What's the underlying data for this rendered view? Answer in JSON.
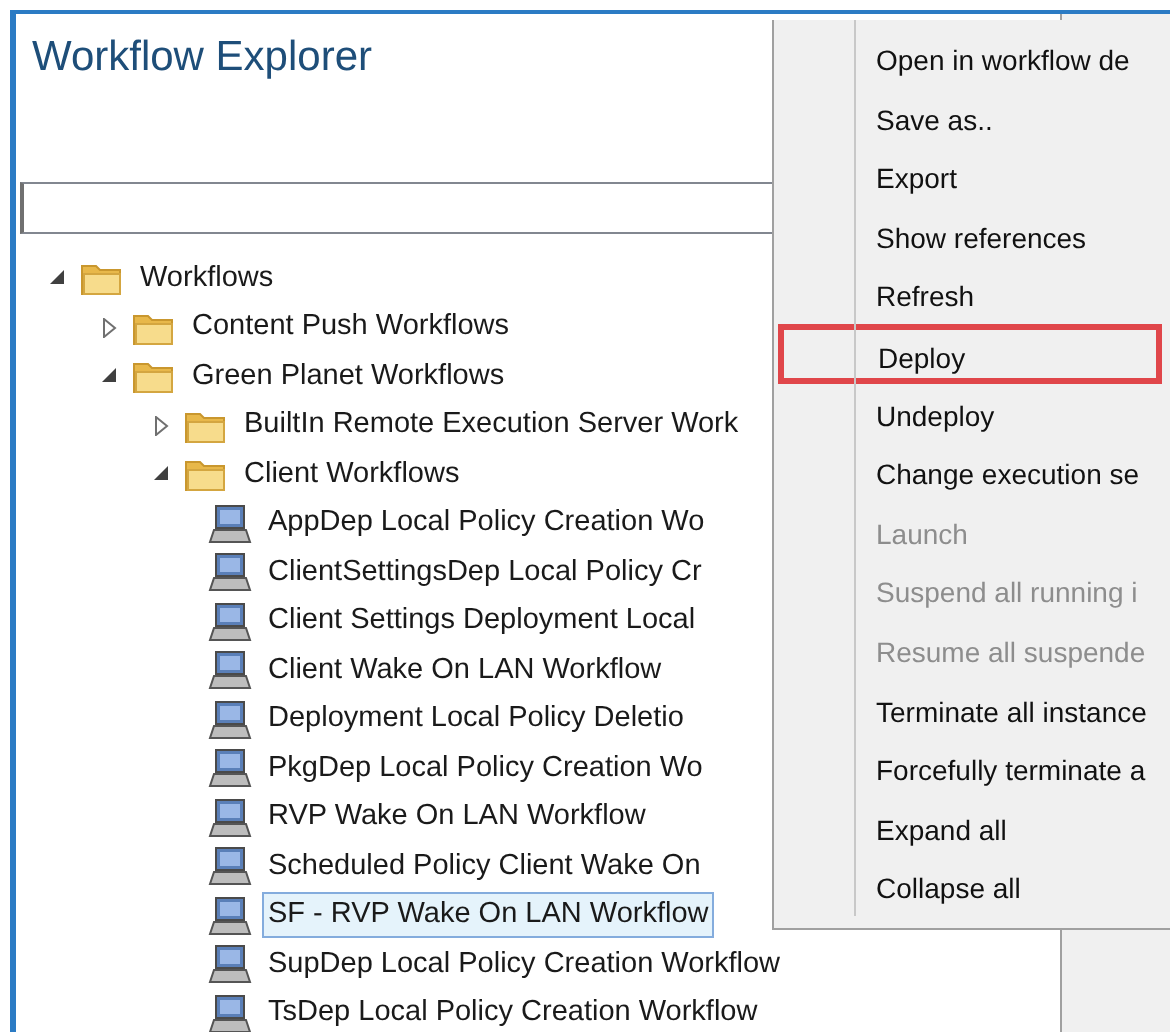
{
  "panel": {
    "title": "Workflow Explorer"
  },
  "tree": [
    {
      "label": "Workflows",
      "kind": "folder",
      "expanded": true,
      "selected": false,
      "children": [
        {
          "label": "Content Push Workflows",
          "kind": "folder",
          "expanded": false,
          "selected": false
        },
        {
          "label": "Green Planet Workflows",
          "kind": "folder",
          "expanded": true,
          "selected": false,
          "children": [
            {
              "label": "BuiltIn Remote Execution Server Work",
              "kind": "folder",
              "expanded": false,
              "selected": false
            },
            {
              "label": "Client Workflows",
              "kind": "folder",
              "expanded": true,
              "selected": false,
              "children": [
                {
                  "label": "AppDep Local Policy Creation Wo",
                  "kind": "workflow",
                  "selected": false
                },
                {
                  "label": "ClientSettingsDep Local Policy Cr",
                  "kind": "workflow",
                  "selected": false
                },
                {
                  "label": "Client Settings Deployment Local",
                  "kind": "workflow",
                  "selected": false
                },
                {
                  "label": "Client Wake On LAN Workflow",
                  "kind": "workflow",
                  "selected": false
                },
                {
                  "label": "Deployment Local Policy Deletio",
                  "kind": "workflow",
                  "selected": false
                },
                {
                  "label": "PkgDep Local Policy Creation Wo",
                  "kind": "workflow",
                  "selected": false
                },
                {
                  "label": "RVP Wake On LAN Workflow",
                  "kind": "workflow",
                  "selected": false
                },
                {
                  "label": "Scheduled Policy Client Wake On",
                  "kind": "workflow",
                  "selected": false
                },
                {
                  "label": "SF - RVP Wake On LAN Workflow",
                  "kind": "workflow",
                  "selected": true
                },
                {
                  "label": "SupDep Local Policy Creation Workflow",
                  "kind": "workflow",
                  "selected": false
                },
                {
                  "label": "TsDep Local Policy Creation Workflow",
                  "kind": "workflow",
                  "selected": false
                }
              ]
            }
          ]
        }
      ]
    }
  ],
  "context_menu": [
    {
      "label": "Open in workflow de",
      "disabled": false,
      "outlined": false
    },
    {
      "label": "Save as..",
      "disabled": false,
      "outlined": false
    },
    {
      "label": "Export",
      "disabled": false,
      "outlined": false
    },
    {
      "label": "Show references",
      "disabled": false,
      "outlined": false
    },
    {
      "label": "Refresh",
      "disabled": false,
      "outlined": false
    },
    {
      "label": "Deploy",
      "disabled": false,
      "outlined": true
    },
    {
      "label": "Undeploy",
      "disabled": false,
      "outlined": false
    },
    {
      "label": "Change execution se",
      "disabled": false,
      "outlined": false
    },
    {
      "label": "Launch",
      "disabled": true,
      "outlined": false
    },
    {
      "label": "Suspend all running i",
      "disabled": true,
      "outlined": false
    },
    {
      "label": "Resume all suspende",
      "disabled": true,
      "outlined": false
    },
    {
      "label": "Terminate all instance",
      "disabled": false,
      "outlined": false
    },
    {
      "label": "Forcefully terminate a",
      "disabled": false,
      "outlined": false
    },
    {
      "label": "Expand all",
      "disabled": false,
      "outlined": false
    },
    {
      "label": "Collapse all",
      "disabled": false,
      "outlined": false
    }
  ]
}
